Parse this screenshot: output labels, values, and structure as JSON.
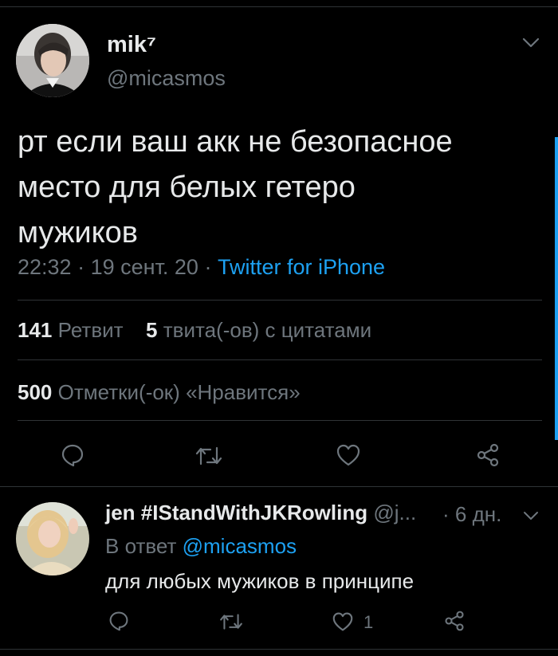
{
  "tweet": {
    "author": {
      "display_name": "mik⁷",
      "handle": "@micasmos"
    },
    "text_lines": [
      "рт если ваш акк не безопасное",
      "место для белых гетеро",
      "мужиков"
    ],
    "time": "22:32",
    "date": "19 сент. 20",
    "source": "Twitter for iPhone",
    "retweets": {
      "count": "141",
      "label": "Ретвит"
    },
    "quotes": {
      "count": "5",
      "label": "твита(-ов) с цитатами"
    },
    "likes": {
      "count": "500",
      "label": "Отметки(-ок) «Нравится»"
    },
    "actions": [
      "reply-icon",
      "retweet-icon",
      "like-icon",
      "share-icon"
    ]
  },
  "reply": {
    "author": {
      "display_name": "jen #IStandWithJKRowling",
      "handle": "@j...",
      "time": "6 дн."
    },
    "reply_to_label": "В ответ",
    "reply_to_handle": "@micasmos",
    "text": "для любых мужиков в принципе",
    "like_count": "1",
    "actions": [
      "reply-icon",
      "retweet-icon",
      "like-icon",
      "share-icon"
    ]
  },
  "colors": {
    "background": "#000000",
    "text": "#e7e9ea",
    "muted": "#6e767d",
    "accent": "#1da1f2",
    "divider": "#2f3336"
  }
}
